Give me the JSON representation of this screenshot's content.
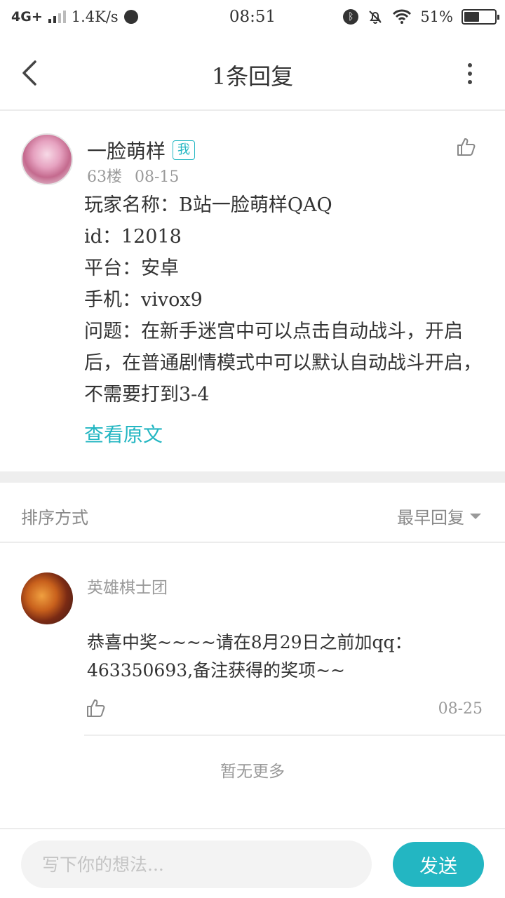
{
  "status_bar": {
    "network": "4G+",
    "speed": "1.4K/s",
    "time": "08:51",
    "battery": "51%",
    "battery_level": 0.51
  },
  "header": {
    "title": "1条回复"
  },
  "post": {
    "username": "一脸萌样",
    "me_tag": "我",
    "floor": "63楼",
    "date": "08-15",
    "lines": [
      "玩家名称：B站一脸萌样QAQ",
      "id：12018",
      "平台：安卓",
      "手机：vivox9",
      "问题：在新手迷宫中可以点击自动战斗，开启后，在普通剧情模式中可以默认自动战斗开启，不需要打到3-4"
    ],
    "view_original": "查看原文"
  },
  "sort": {
    "label": "排序方式",
    "value": "最早回复"
  },
  "reply": {
    "username": "英雄棋士团",
    "content": "恭喜中奖~~~~请在8月29日之前加qq：463350693,备注获得的奖项~~",
    "date": "08-25"
  },
  "no_more": "暂无更多",
  "bottom": {
    "placeholder": "写下你的想法...",
    "send": "发送"
  },
  "colors": {
    "accent": "#23b6c2",
    "muted": "#999999"
  }
}
